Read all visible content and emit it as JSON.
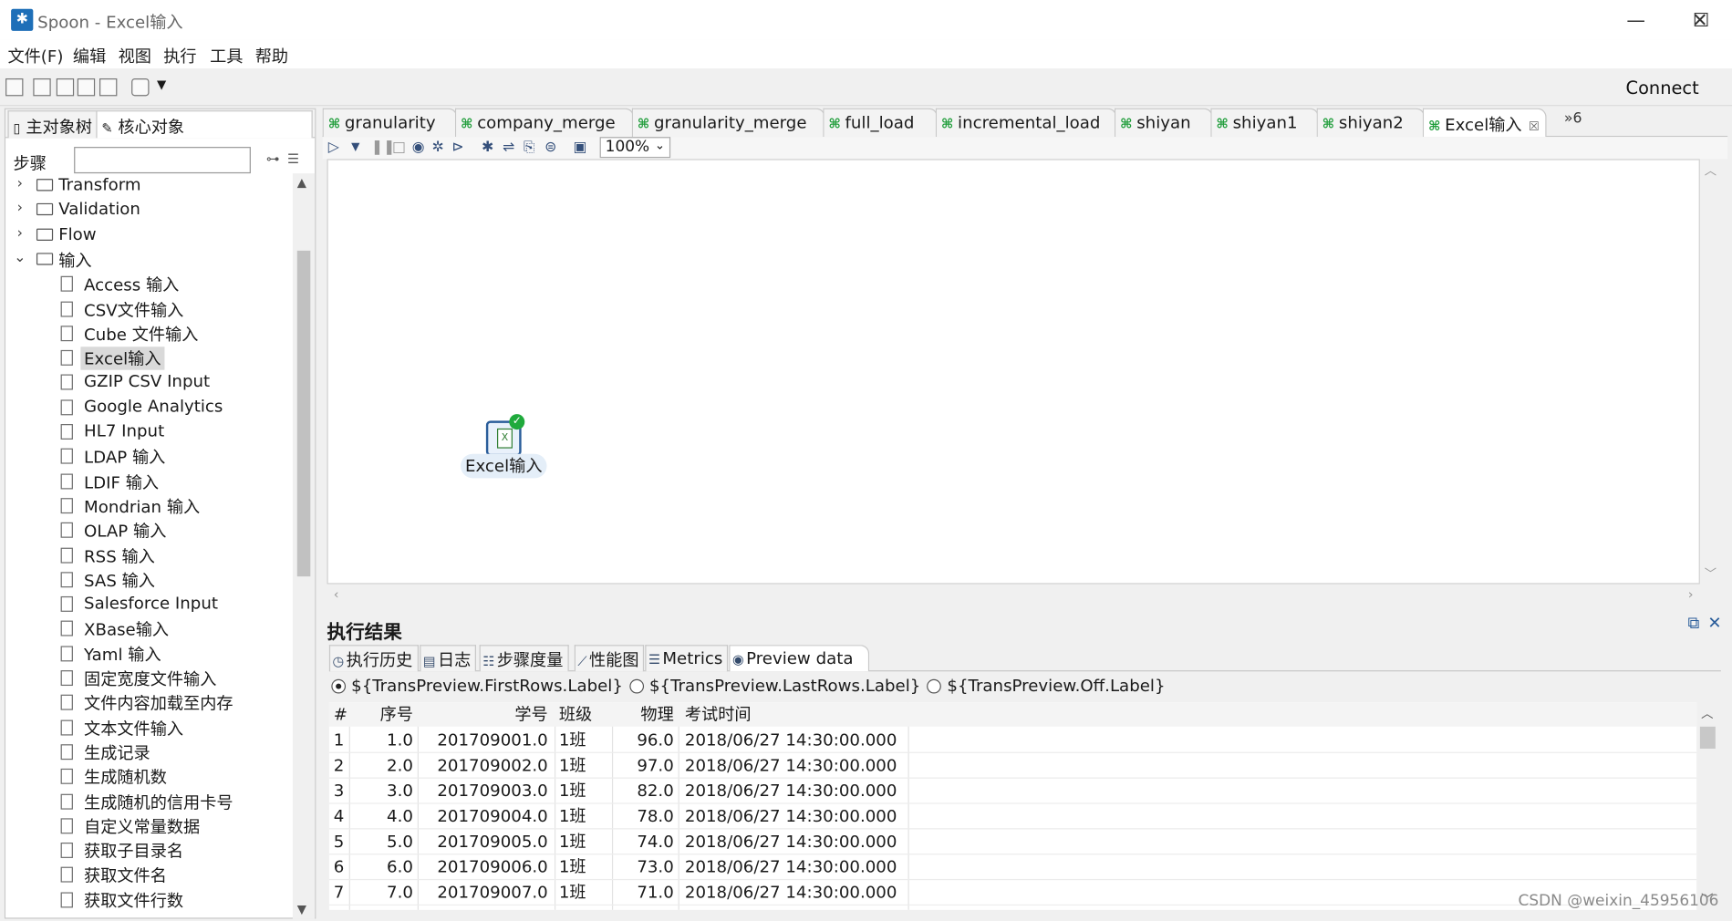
{
  "window": {
    "title": "Spoon - Excel输入",
    "controls": [
      "—",
      "☐",
      "✕"
    ]
  },
  "menubar": [
    "文件(F)",
    "编辑",
    "视图",
    "执行",
    "工具",
    "帮助"
  ],
  "toolbar": {
    "connect_label": "Connect"
  },
  "left_panel": {
    "tabs": [
      "主对象树",
      "核心对象"
    ],
    "search_label": "步骤",
    "search_value": "",
    "tree": [
      {
        "label": "Transform",
        "type": "folder",
        "expanded": false
      },
      {
        "label": "Validation",
        "type": "folder",
        "expanded": false
      },
      {
        "label": "Flow",
        "type": "folder",
        "expanded": false
      },
      {
        "label": "输入",
        "type": "folder",
        "expanded": true
      },
      {
        "label": "Access 输入",
        "type": "leaf"
      },
      {
        "label": "CSV文件输入",
        "type": "leaf"
      },
      {
        "label": "Cube 文件输入",
        "type": "leaf"
      },
      {
        "label": "Excel输入",
        "type": "leaf",
        "selected": true
      },
      {
        "label": "GZIP CSV Input",
        "type": "leaf"
      },
      {
        "label": "Google Analytics",
        "type": "leaf"
      },
      {
        "label": "HL7 Input",
        "type": "leaf"
      },
      {
        "label": "LDAP 输入",
        "type": "leaf"
      },
      {
        "label": "LDIF 输入",
        "type": "leaf"
      },
      {
        "label": "Mondrian 输入",
        "type": "leaf"
      },
      {
        "label": "OLAP 输入",
        "type": "leaf"
      },
      {
        "label": "RSS 输入",
        "type": "leaf"
      },
      {
        "label": "SAS 输入",
        "type": "leaf"
      },
      {
        "label": "Salesforce Input",
        "type": "leaf"
      },
      {
        "label": "XBase输入",
        "type": "leaf"
      },
      {
        "label": "Yaml 输入",
        "type": "leaf"
      },
      {
        "label": "固定宽度文件输入",
        "type": "leaf"
      },
      {
        "label": "文件内容加载至内存",
        "type": "leaf"
      },
      {
        "label": "文本文件输入",
        "type": "leaf"
      },
      {
        "label": "生成记录",
        "type": "leaf"
      },
      {
        "label": "生成随机数",
        "type": "leaf"
      },
      {
        "label": "生成随机的信用卡号",
        "type": "leaf"
      },
      {
        "label": "自定义常量数据",
        "type": "leaf"
      },
      {
        "label": "获取子目录名",
        "type": "leaf"
      },
      {
        "label": "获取文件名",
        "type": "leaf"
      },
      {
        "label": "获取文件行数",
        "type": "leaf"
      }
    ]
  },
  "doc_tabs": [
    {
      "label": "granularity"
    },
    {
      "label": "company_merge"
    },
    {
      "label": "granularity_merge"
    },
    {
      "label": "full_load"
    },
    {
      "label": "incremental_load"
    },
    {
      "label": "shiyan"
    },
    {
      "label": "shiyan1"
    },
    {
      "label": "shiyan2"
    },
    {
      "label": "Excel输入",
      "active": true
    }
  ],
  "doc_tabs_more": "»6",
  "canvas_toolbar": {
    "zoom": "100%"
  },
  "canvas": {
    "step_label": "Excel输入"
  },
  "results": {
    "title": "执行结果",
    "tabs": [
      "执行历史",
      "日志",
      "步骤度量",
      "性能图",
      "Metrics",
      "Preview data"
    ],
    "active_tab": "Preview data",
    "radio_options": [
      {
        "label": "${TransPreview.FirstRows.Label}",
        "selected": true
      },
      {
        "label": "${TransPreview.LastRows.Label}",
        "selected": false
      },
      {
        "label": "${TransPreview.Off.Label}",
        "selected": false
      }
    ],
    "columns": [
      "#",
      "序号",
      "学号",
      "班级",
      "物理",
      "考试时间"
    ],
    "rows": [
      [
        "1",
        "1.0",
        "201709001.0",
        "1班",
        "96.0",
        "2018/06/27 14:30:00.000"
      ],
      [
        "2",
        "2.0",
        "201709002.0",
        "1班",
        "97.0",
        "2018/06/27 14:30:00.000"
      ],
      [
        "3",
        "3.0",
        "201709003.0",
        "1班",
        "82.0",
        "2018/06/27 14:30:00.000"
      ],
      [
        "4",
        "4.0",
        "201709004.0",
        "1班",
        "78.0",
        "2018/06/27 14:30:00.000"
      ],
      [
        "5",
        "5.0",
        "201709005.0",
        "1班",
        "74.0",
        "2018/06/27 14:30:00.000"
      ],
      [
        "6",
        "6.0",
        "201709006.0",
        "1班",
        "73.0",
        "2018/06/27 14:30:00.000"
      ],
      [
        "7",
        "7.0",
        "201709007.0",
        "1班",
        "71.0",
        "2018/06/27 14:30:00.000"
      ]
    ]
  },
  "watermark": "CSDN @weixin_45956106"
}
